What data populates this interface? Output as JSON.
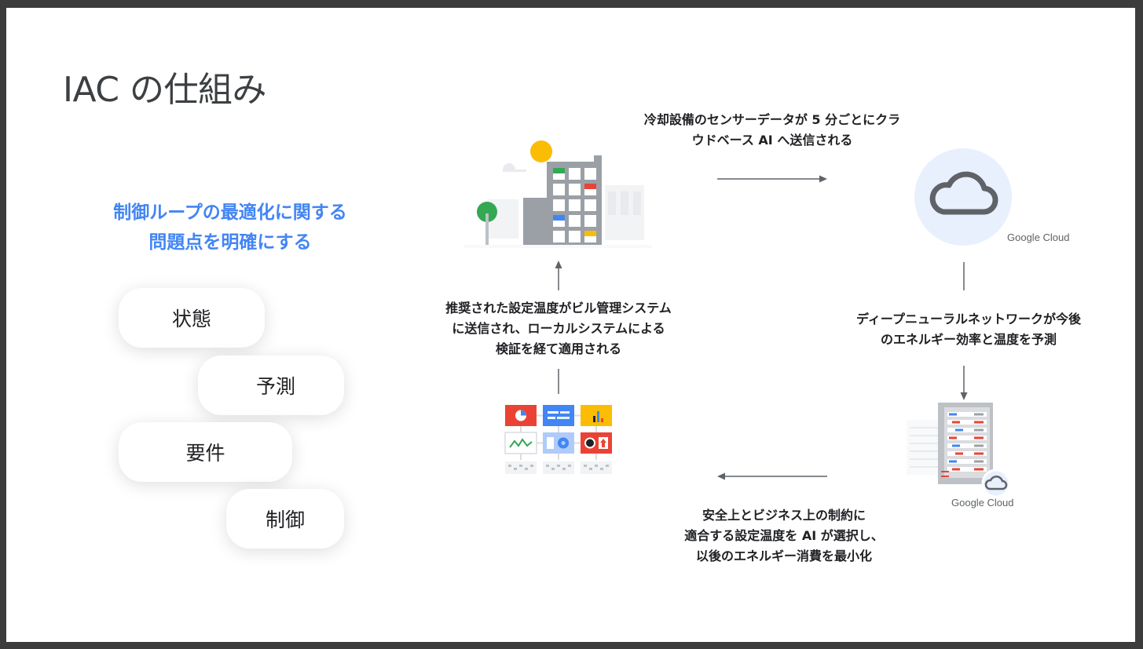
{
  "slide": {
    "title": "IAC の仕組み",
    "subtitle_lines": [
      "制御ループの最適化に関する",
      "問題点を明確にする"
    ],
    "steps": [
      "状態",
      "予測",
      "要件",
      "制御"
    ]
  },
  "diagram": {
    "cloud_send_lines": [
      "冷却設備のセンサーデータが 5 分ごとにクラ",
      "ウドベース AI へ送信される"
    ],
    "dnn_lines": [
      "ディープニューラルネットワークが今後",
      "のエネルギー効率と温度を予測"
    ],
    "ai_select_lines": [
      "安全上とビジネス上の制約に",
      "適合する設定温度を AI が選択し、",
      "以後のエネルギー消費を最小化"
    ],
    "bms_lines": [
      "推奨された設定温度がビル管理システム",
      "に送信され、ローカルシステムによる",
      "検証を経て適用される"
    ],
    "google_cloud_label_top": "Google Cloud",
    "google_cloud_label_bottom": "Google Cloud"
  },
  "icons": [
    "building-icon",
    "cloud-icon",
    "server-icon",
    "dashboard-icon"
  ],
  "colors": {
    "accent_blue": "#4285f4",
    "google_red": "#ea4335",
    "google_yellow": "#fbbc04",
    "google_green": "#34a853",
    "gray": "#9aa0a6"
  }
}
